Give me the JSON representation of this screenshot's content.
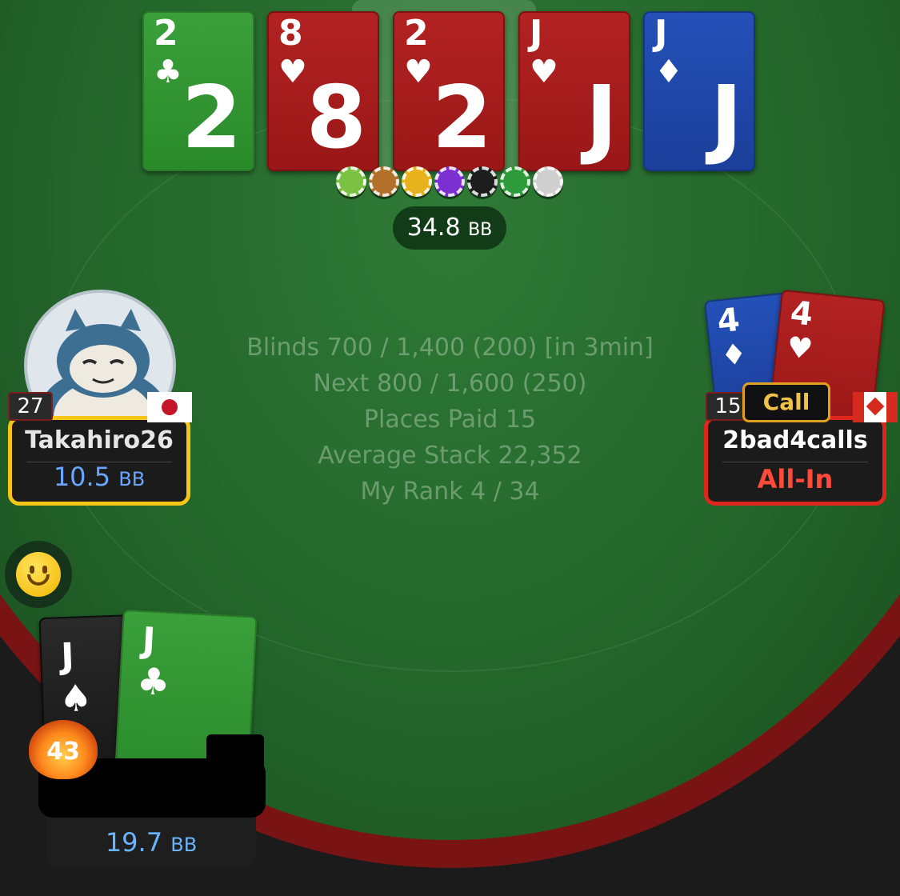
{
  "board": {
    "cards": [
      {
        "rank": "2",
        "suit": "♣",
        "color": "green",
        "name": "board-card-2-clubs"
      },
      {
        "rank": "8",
        "suit": "♥",
        "color": "red",
        "name": "board-card-8-hearts"
      },
      {
        "rank": "2",
        "suit": "♥",
        "color": "red",
        "name": "board-card-2-hearts"
      },
      {
        "rank": "J",
        "suit": "♥",
        "color": "red",
        "name": "board-card-j-hearts"
      },
      {
        "rank": "J",
        "suit": "♦",
        "color": "blue",
        "name": "board-card-j-diamonds"
      }
    ],
    "chip_colors": [
      "#7bc142",
      "#b3702a",
      "#e8b21c",
      "#7b2fd1",
      "#1d1d1d",
      "#2e9c3a",
      "#cfcfcf"
    ],
    "pot": {
      "amount": "34.8",
      "unit": "BB"
    }
  },
  "info": {
    "blinds": "Blinds 700 / 1,400 (200) [in 3min]",
    "next": "Next 800 / 1,600 (250)",
    "places_paid": "Places Paid 15",
    "average_stack": "Average Stack 22,352",
    "my_rank": "My Rank 4 / 34"
  },
  "players": {
    "left": {
      "name": "Takahiro26",
      "stack": "10.5",
      "unit": "BB",
      "level": "27",
      "country": "Japan",
      "avatar": "snorlax-avatar"
    },
    "right": {
      "name": "2bad4calls",
      "status": "All-In",
      "action": "Call",
      "level": "15",
      "country": "Canada",
      "cards": [
        {
          "rank": "4",
          "suit": "♦",
          "color": "blue"
        },
        {
          "rank": "4",
          "suit": "♥",
          "color": "red"
        }
      ]
    },
    "hero": {
      "stack": "19.7",
      "unit": "BB",
      "level": "43",
      "cards": [
        {
          "rank": "J",
          "suit": "♠",
          "color": "black"
        },
        {
          "rank": "J",
          "suit": "♣",
          "color": "green"
        }
      ]
    }
  },
  "colors": {
    "felt": "#23652a",
    "rail": "#7a1414",
    "active_border": "#f5c518",
    "allin_border": "#e0261c",
    "stack_blue": "#6aa6ff",
    "allin_red": "#ff4a3a"
  }
}
